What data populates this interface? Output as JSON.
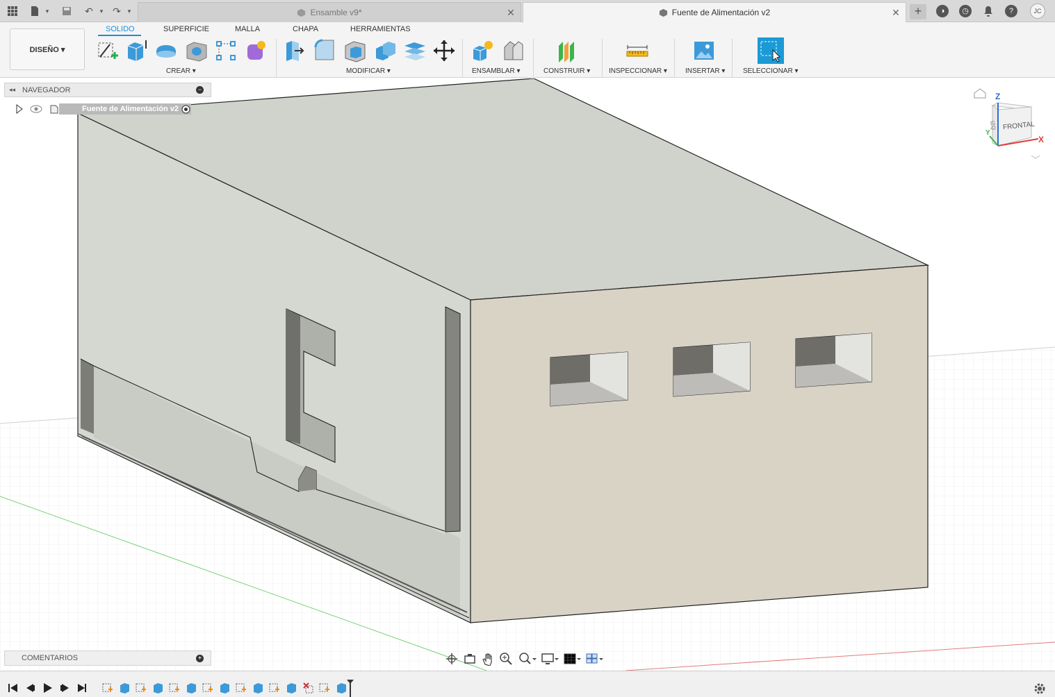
{
  "titlebar": {
    "tabs": [
      {
        "label": "Ensamble v9*",
        "active": false
      },
      {
        "label": "Fuente de Alimentación v2",
        "active": true
      }
    ],
    "user_initials": "JC"
  },
  "toolbar": {
    "workspace_button": "DISEÑO ▾",
    "workspace_tabs": [
      "SOLIDO",
      "SUPERFICIE",
      "MALLA",
      "CHAPA",
      "HERRAMIENTAS"
    ],
    "active_workspace_tab": "SOLIDO",
    "groups": [
      {
        "label": "CREAR ▾"
      },
      {
        "label": "MODIFICAR ▾"
      },
      {
        "label": "ENSAMBLAR ▾"
      },
      {
        "label": "CONSTRUIR ▾"
      },
      {
        "label": "INSPECCIONAR ▾"
      },
      {
        "label": "INSERTAR ▾"
      },
      {
        "label": "SELECCIONAR ▾"
      }
    ]
  },
  "navigator": {
    "title": "NAVEGADOR",
    "root_item": "Fuente de Alimentación v2"
  },
  "comments": {
    "title": "COMENTARIOS"
  },
  "viewcube": {
    "face_label": "FRONTAL",
    "side_label": "IZQ",
    "axis_z": "Z",
    "axis_x": "X",
    "axis_y": "Y"
  },
  "colors": {
    "accent": "#1a8fd6",
    "select_tool": "#1b9ad6",
    "model_face_front": "#d9d3c6",
    "model_face_top": "#d0d3cb",
    "model_face_side": "#d3d6cf"
  }
}
